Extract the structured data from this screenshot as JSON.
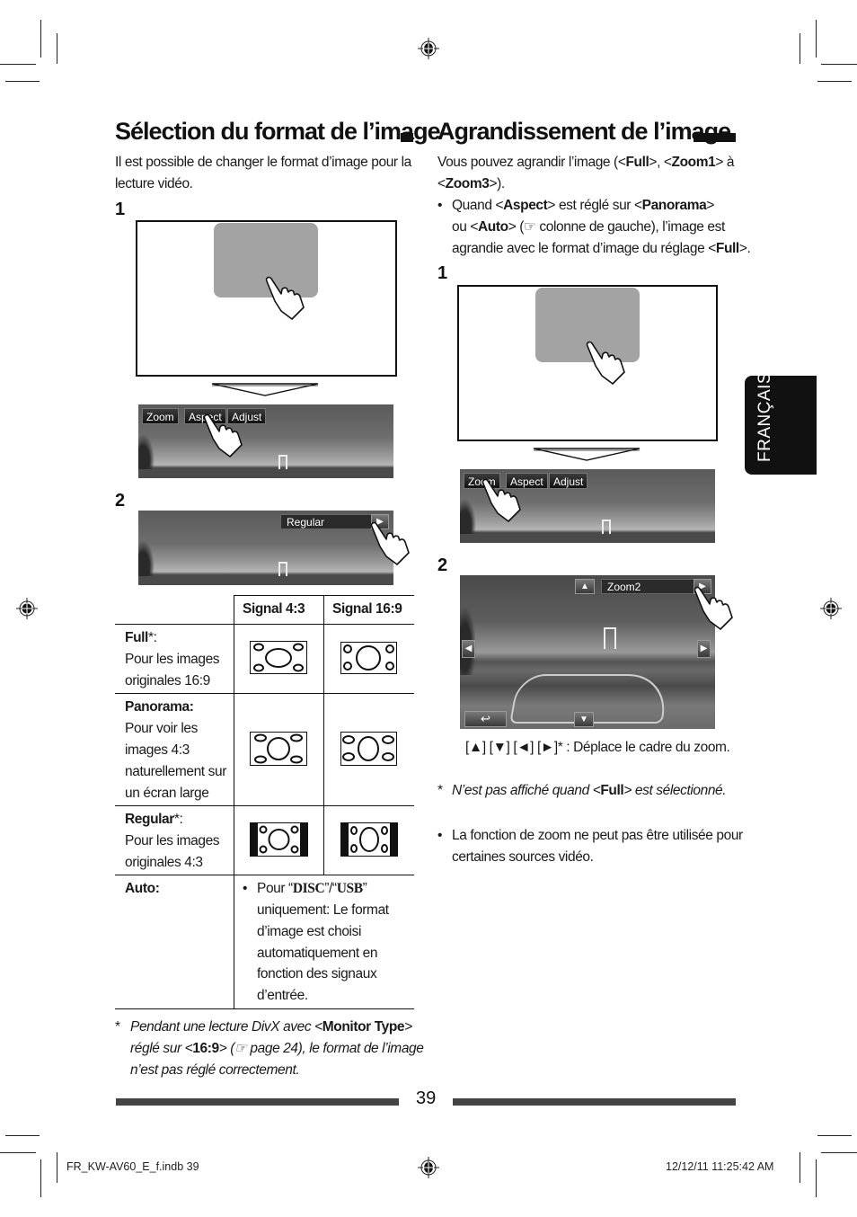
{
  "left_section": {
    "title": "Sélection du format de l’image",
    "intro_line1": "Il est possible de changer le format d’image pour la",
    "intro_line2": "lecture vidéo.",
    "step1": "1",
    "step2": "2",
    "osd_buttons": [
      "Zoom",
      "Aspect",
      "Adjust"
    ],
    "aspect_value": "Regular",
    "table": {
      "headers": [
        "",
        "Signal 4:3",
        "Signal 16:9"
      ],
      "rows": [
        {
          "name": "Full",
          "suffix": "*:",
          "desc_lines": [
            "Pour les images",
            "originales 16:9"
          ]
        },
        {
          "name": "Panorama:",
          "suffix": "",
          "desc_lines": [
            "Pour voir les",
            "images 4:3",
            "naturellement sur",
            "un écran large"
          ]
        },
        {
          "name": "Regular",
          "suffix": "*:",
          "desc_lines": [
            "Pour les images",
            "originales 4:3"
          ]
        },
        {
          "name": "Auto:",
          "suffix": "",
          "desc_lines": []
        }
      ],
      "auto_bullet": "•",
      "auto_pour": "Pour “",
      "auto_disc": "DISC",
      "auto_sep": "”/“",
      "auto_usb": "USB",
      "auto_close": "”",
      "auto_lines": [
        "uniquement: Le format",
        "d’image est choisi",
        "automatiquement en",
        "fonction des signaux",
        "d’entrée."
      ]
    },
    "footnote": {
      "star": "*",
      "line1_a": "Pendant une lecture DivX avec <",
      "line1_b": "Monitor Type",
      "line1_c": ">",
      "line2_a": "réglé sur <",
      "line2_b": "16:9",
      "line2_c": "> (☞ page 24), le format de l’image",
      "line3": "n’est pas réglé correctement."
    }
  },
  "right_section": {
    "title": "Agrandissement de l’image",
    "intro_a": "Vous pouvez agrandir l’image (<",
    "intro_full": "Full",
    "intro_b": ">, <",
    "intro_zoom1": "Zoom1",
    "intro_c": "> à",
    "intro2_a": "<",
    "intro2_zoom3": "Zoom3",
    "intro2_b": ">).",
    "bullet": "•",
    "b1_a": "Quand <",
    "b1_aspect": "Aspect",
    "b1_b": "> est réglé sur <",
    "b1_panorama": "Panorama",
    "b1_c": ">",
    "b2_a": "ou <",
    "b2_auto": "Auto",
    "b2_b": "> (☞ colonne de gauche), l’image est",
    "b3_a": "agrandie avec le format d’image du réglage <",
    "b3_full": "Full",
    "b3_b": ">.",
    "step1": "1",
    "step2": "2",
    "osd_buttons": [
      "Zoom",
      "Aspect",
      "Adjust"
    ],
    "zoom_value": "Zoom2",
    "back_symbol": "↩",
    "caption": "[▲] [▼] [◄] [►]* : Déplace le cadre du zoom.",
    "footnote_star": "*",
    "footnote_a": "N’est pas affiché quand <",
    "footnote_full": "Full",
    "footnote_b": "> est sélectionné.",
    "note_bullet": "•",
    "note_line1": "La fonction de zoom ne peut pas être utilisée pour",
    "note_line2": "certaines sources vidéo."
  },
  "language_tab": "FRANÇAIS",
  "page_number": "39",
  "slug": {
    "file": "FR_KW-AV60_E_f.indb   39",
    "timestamp": "12/12/11   11:25:42 AM"
  }
}
